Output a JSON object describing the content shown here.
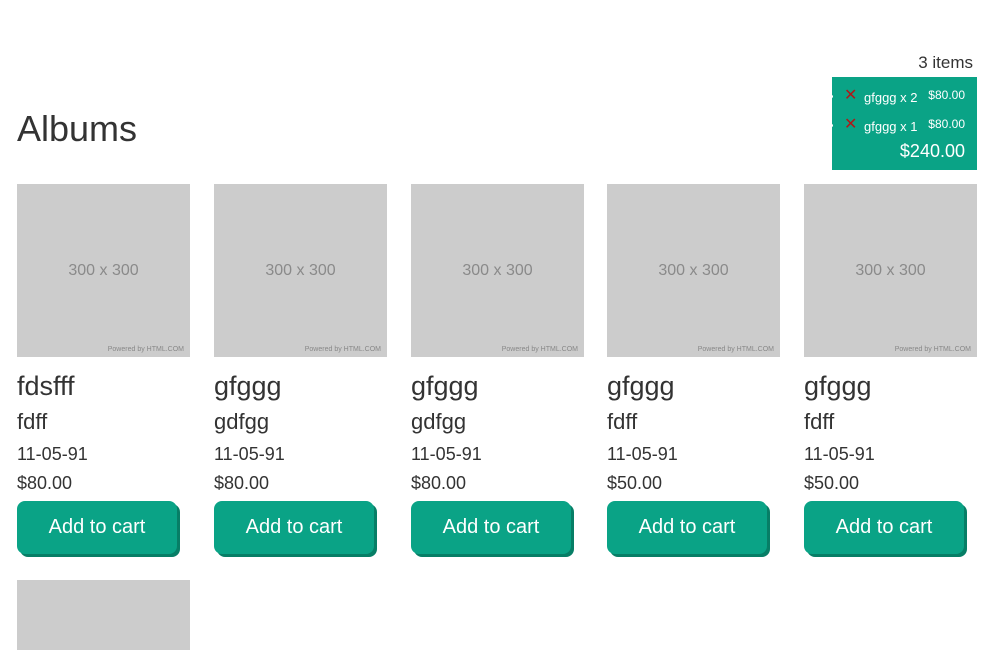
{
  "cart": {
    "count_label": "3 items",
    "lines": [
      {
        "remove_icon": "✕",
        "name": "gfggg x 2",
        "price": "$80.00"
      },
      {
        "remove_icon": "✕",
        "name": "gfggg x 1",
        "price": "$80.00"
      }
    ],
    "total": "$240.00"
  },
  "page": {
    "title": "Albums"
  },
  "albums": [
    {
      "image_text": "300 x 300",
      "image_credit": "Powered by HTML.COM",
      "title": "fdsfff",
      "artist": "fdff",
      "date": "11-05-91",
      "price": "$80.00",
      "button": "Add to cart"
    },
    {
      "image_text": "300 x 300",
      "image_credit": "Powered by HTML.COM",
      "title": "gfggg",
      "artist": "gdfgg",
      "date": "11-05-91",
      "price": "$80.00",
      "button": "Add to cart"
    },
    {
      "image_text": "300 x 300",
      "image_credit": "Powered by HTML.COM",
      "title": "gfggg",
      "artist": "gdfgg",
      "date": "11-05-91",
      "price": "$80.00",
      "button": "Add to cart"
    },
    {
      "image_text": "300 x 300",
      "image_credit": "Powered by HTML.COM",
      "title": "gfggg",
      "artist": "fdff",
      "date": "11-05-91",
      "price": "$50.00",
      "button": "Add to cart"
    },
    {
      "image_text": "300 x 300",
      "image_credit": "Powered by HTML.COM",
      "title": "gfggg",
      "artist": "fdff",
      "date": "11-05-91",
      "price": "$50.00",
      "button": "Add to cart"
    }
  ]
}
